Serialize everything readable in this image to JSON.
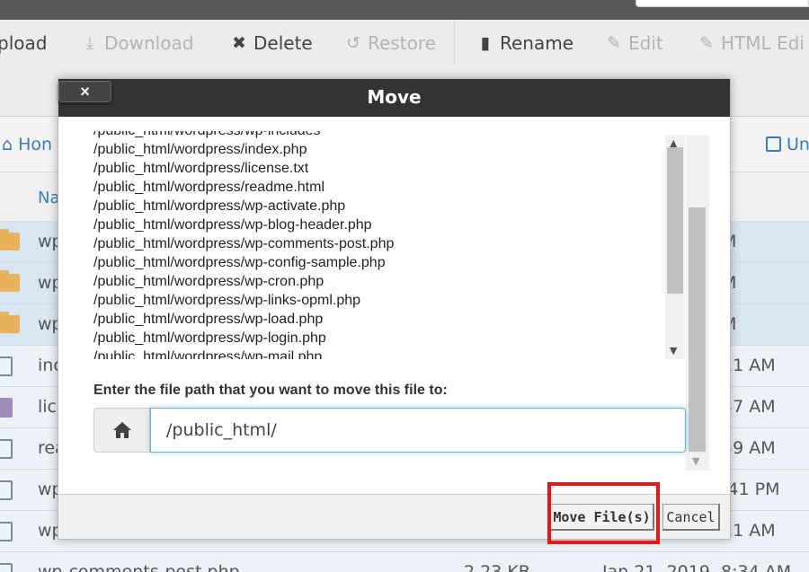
{
  "toolbar": {
    "upload": "pload",
    "download": "Download",
    "delete": "Delete",
    "restore": "Restore",
    "rename": "Rename",
    "edit": "Edit",
    "html_edit": "HTML Edi"
  },
  "nav": {
    "home": "Hon",
    "unselect": "Un"
  },
  "columns": {
    "name": "Na"
  },
  "rows": [
    {
      "type": "folder",
      "name": "wp",
      "time": "M"
    },
    {
      "type": "folder",
      "name": "wp",
      "time": "M"
    },
    {
      "type": "folder",
      "name": "wp",
      "time": "M"
    },
    {
      "type": "file",
      "name": "inc",
      "time": "11 AM"
    },
    {
      "type": "text",
      "name": "lic",
      "time": "37 AM"
    },
    {
      "type": "file",
      "name": "rea",
      "time": "59 AM"
    },
    {
      "type": "file",
      "name": "wp",
      "time": ":41 PM"
    },
    {
      "type": "file",
      "name": "wp",
      "time": "11 AM"
    },
    {
      "type": "file",
      "name": "wp-comments-post.php",
      "size": "2.23 KB",
      "date": "Jan 21, 2019, 8:34 AM"
    }
  ],
  "dialog": {
    "title": "Move",
    "close_label": "×",
    "files": [
      "/public_html/wordpress/wp-includes",
      "/public_html/wordpress/index.php",
      "/public_html/wordpress/license.txt",
      "/public_html/wordpress/readme.html",
      "/public_html/wordpress/wp-activate.php",
      "/public_html/wordpress/wp-blog-header.php",
      "/public_html/wordpress/wp-comments-post.php",
      "/public_html/wordpress/wp-config-sample.php",
      "/public_html/wordpress/wp-cron.php",
      "/public_html/wordpress/wp-links-opml.php",
      "/public_html/wordpress/wp-load.php",
      "/public_html/wordpress/wp-login.php",
      "/public_html/wordpress/wp-mail.php"
    ],
    "prompt": "Enter the file path that you want to move this file to:",
    "path_value": "/public_html/",
    "move_button": "Move File(s)",
    "cancel_button": "Cancel"
  },
  "colors": {
    "highlight": "#e8161b",
    "header_bg": "#333333",
    "link": "#3a7cb8"
  }
}
